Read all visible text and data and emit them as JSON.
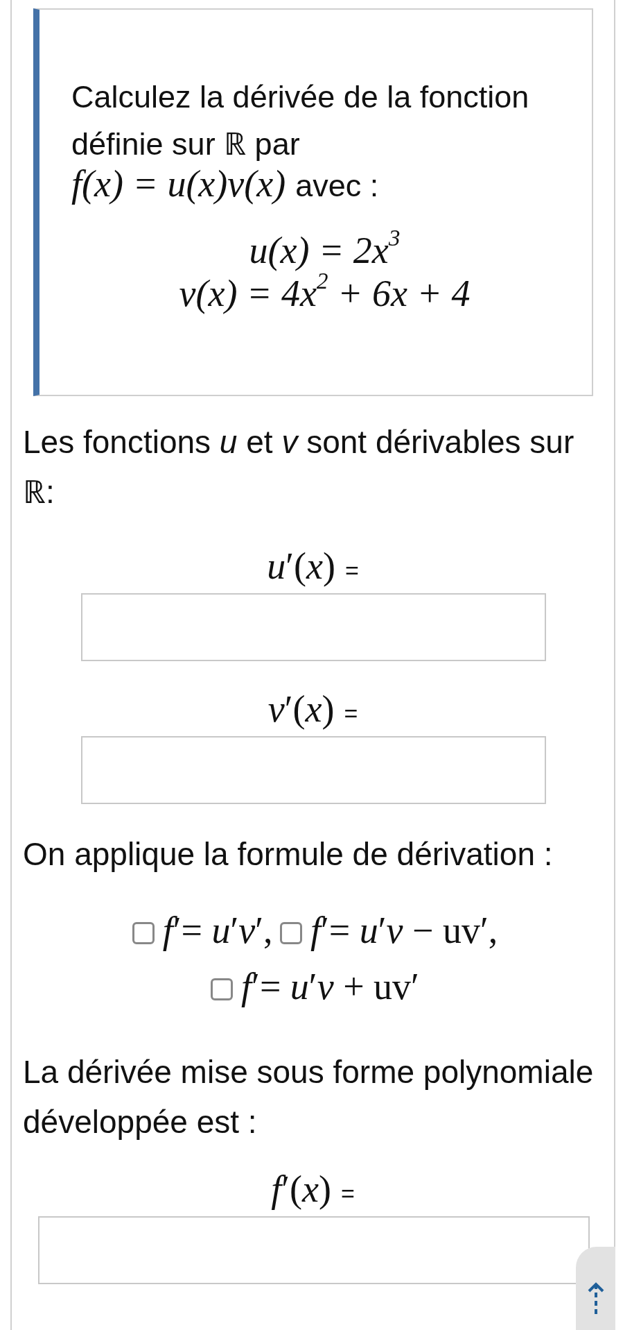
{
  "statement": {
    "text": "Calculez la dérivée de la fonction définie sur  ℝ par",
    "formula": "f(x) = u(x)v(x)",
    "formula_suffix": "avec :",
    "definitions": [
      "u(x) = 2x$^{3}$",
      "v(x) = 4x$^{2}$ + 6x + 4"
    ]
  },
  "intro": "Les fonctions *u* et *v* sont dérivables sur ℝ:",
  "fields": [
    {
      "label": "*u*′(*x*)",
      "equals": "="
    },
    {
      "label": "*v*′(*x*)",
      "equals": "="
    }
  ],
  "method_prompt": "On applique la formule de dérivation :",
  "options": [
    {
      "label": "*f*′= *u*′*v*′,",
      "checked": false
    },
    {
      "label": "*f*′= *u*′*v* − uv′,",
      "checked": false
    },
    {
      "label": "*f*′= *u*′*v* + uv′",
      "checked": false
    }
  ],
  "result_prompt": "La dérivée mise sous forme polynomiale développée est :",
  "result_field": {
    "label": "*f*′(*x*)",
    "equals": "="
  }
}
